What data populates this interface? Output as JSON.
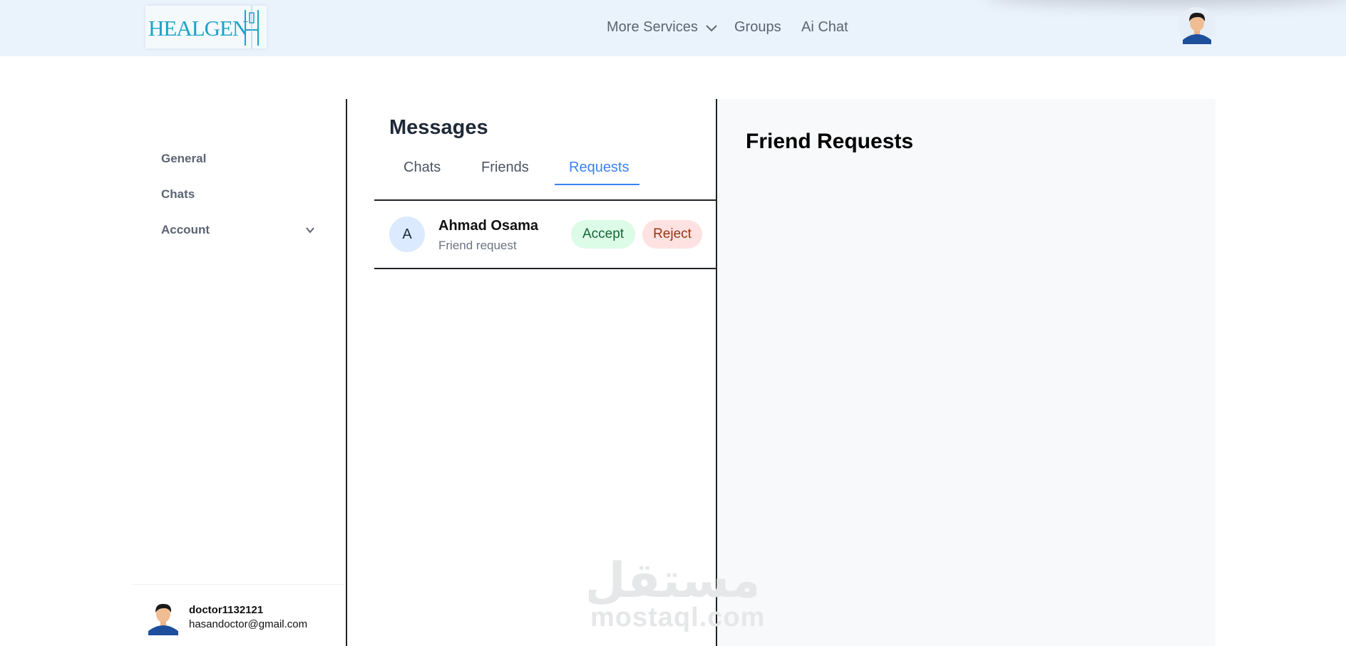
{
  "header": {
    "logo_text": "HEALGEN",
    "nav": {
      "more_services": "More Services",
      "groups": "Groups",
      "ai_chat": "Ai Chat"
    }
  },
  "sidebar": {
    "items": [
      {
        "label": "General"
      },
      {
        "label": "Chats"
      },
      {
        "label": "Account"
      }
    ],
    "user": {
      "username": "doctor1132121",
      "email": "hasandoctor@gmail.com"
    }
  },
  "messages": {
    "title": "Messages",
    "tabs": [
      {
        "label": "Chats"
      },
      {
        "label": "Friends"
      },
      {
        "label": "Requests",
        "active": true
      }
    ],
    "requests": [
      {
        "initial": "A",
        "name": "Ahmad Osama",
        "subtitle": "Friend request",
        "accept_label": "Accept",
        "reject_label": "Reject"
      }
    ]
  },
  "right_panel": {
    "title": "Friend Requests"
  },
  "watermark": {
    "arabic": "مستقل",
    "latin": "mostaql.com"
  },
  "colors": {
    "accent": "#3b82f6",
    "header_bg": "#eaf2fc",
    "accept_bg": "#dcfce7",
    "reject_bg": "#fee2e2"
  }
}
